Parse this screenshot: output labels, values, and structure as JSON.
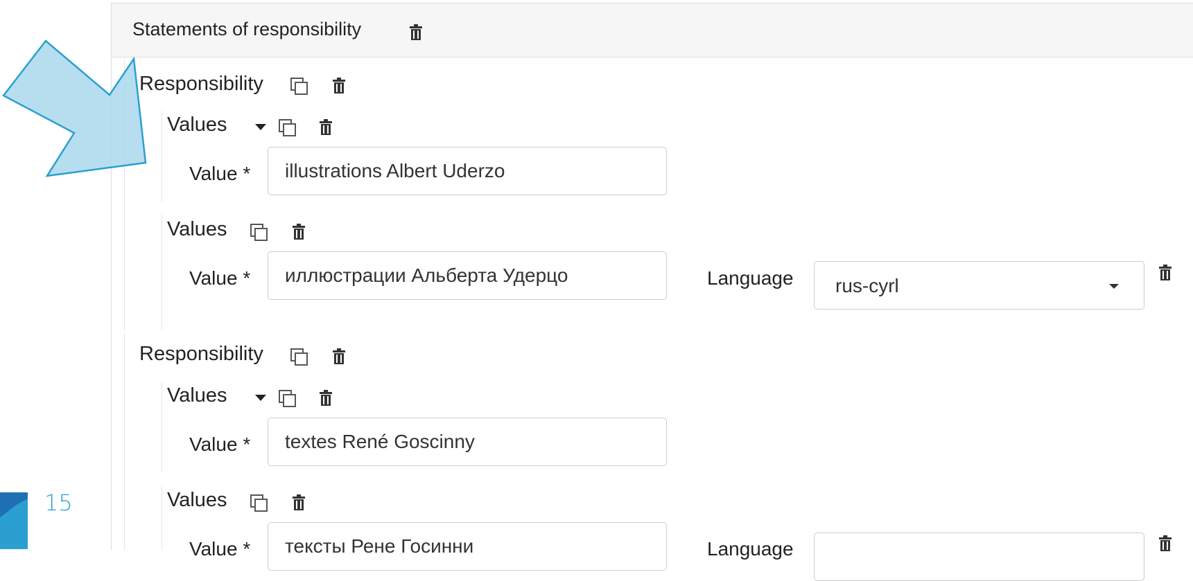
{
  "section": {
    "title": "Statements of responsibility"
  },
  "responsibilities": [
    {
      "label": "Responsibility",
      "values_groups": [
        {
          "label": "Values",
          "value_label": "Value *",
          "value": "illustrations Albert Uderzo"
        },
        {
          "label": "Values",
          "value_label": "Value *",
          "value": "иллюстрации Альберта Удерцо",
          "language_label": "Language",
          "language_value": "rus-cyrl"
        }
      ]
    },
    {
      "label": "Responsibility",
      "values_groups": [
        {
          "label": "Values",
          "value_label": "Value *",
          "value": "textes René Goscinny"
        },
        {
          "label": "Values",
          "value_label": "Value *",
          "value": "тексты Рене Госинни",
          "language_label": "Language",
          "language_value": ""
        }
      ]
    }
  ],
  "slide_number": "15",
  "colors": {
    "arrow_fill": "#a9d8ec",
    "arrow_stroke": "#2a9fd0",
    "accent": "#1f8fc8"
  }
}
